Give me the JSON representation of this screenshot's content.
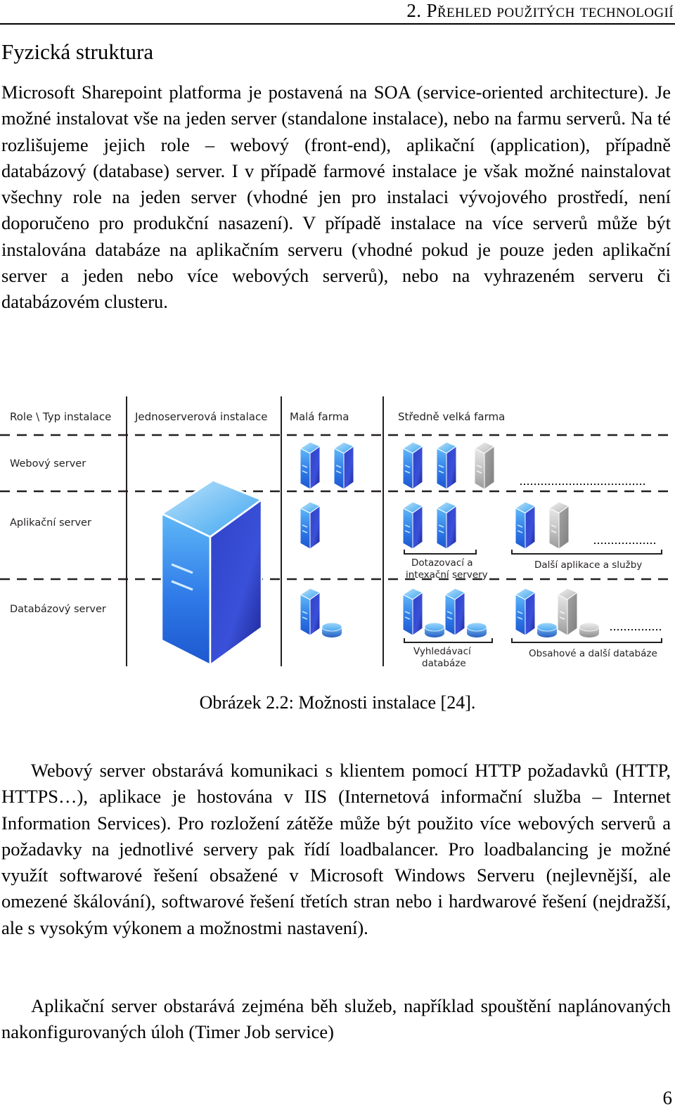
{
  "header": {
    "chapter_title": "2. Přehled použitých technologií",
    "page_number": "6"
  },
  "section": {
    "heading": "Fyzická struktura"
  },
  "paragraphs": {
    "p1": "Microsoft Sharepoint platforma je postavená na SOA (service-oriented architecture). Je možné instalovat vše na jeden server (standalone instalace), nebo na farmu serverů. Na té rozlišujeme jejich role – webový (front-end), aplikační (application), případně databázový (database) server. I v případě farmové instalace je však možné nainstalovat všechny role na jeden server (vhodné jen pro instalaci vývojového prostředí, není doporučeno pro produkční nasazení). V případě instalace na více serverů může být instalována databáze na aplikačním serveru (vhodné pokud je pouze jeden aplikační server a jeden nebo více webových serverů), nebo na vyhrazeném serveru či databázovém clusteru.",
    "p3": "Webový server obstarává komunikaci s klientem pomocí HTTP požadavků (HTTP, HTTPS…), aplikace je hostována v IIS (Internetová informační služba – Internet Information Services). Pro rozložení zátěže může být použito více webových serverů a požadavky na jednotlivé servery pak řídí loadbalancer. Pro loadbalancing je možné využít softwarové řešení obsažené v Microsoft Windows Serveru (nejlevnější, ale omezené škálování), softwarové řešení třetích stran nebo i hardwarové řešení (nejdražší, ale s vysokým výkonem a možnostmi nastavení).",
    "p4": "Aplikační server obstarává zejména běh služeb, například spouštění naplánovaných nakonfigurovaných úloh (Timer Job service)"
  },
  "figure": {
    "caption": "Obrázek 2.2: Možnosti instalace [24].",
    "corner_label": "Role \\ Typ instalace",
    "columns": [
      {
        "id": "single",
        "label": "Jednoserverová instalace"
      },
      {
        "id": "small-farm",
        "label": "Malá farma"
      },
      {
        "id": "medium-farm",
        "label": "Středně velká farma"
      }
    ],
    "rows": [
      {
        "id": "web",
        "label": "Webový server"
      },
      {
        "id": "app",
        "label": "Aplikační server"
      },
      {
        "id": "db",
        "label": "Databázový server"
      }
    ],
    "group_labels": {
      "query_index": [
        "Dotazovací a",
        "intexační servery"
      ],
      "other_apps": [
        "Další aplikace a služby"
      ],
      "search_db": [
        "Vyhledávací",
        "databáze"
      ],
      "content_db": [
        "Obsahové a další databáze"
      ]
    },
    "colors": {
      "server_blue_light": "#4eb3f5",
      "server_blue_mid": "#2b6fe0",
      "server_blue_dark": "#1f2fb4",
      "server_grey_light": "#dcdcdc",
      "server_grey_mid": "#a8a8a8",
      "server_grey_dark": "#8a8a8a",
      "line": "#231f20"
    }
  }
}
